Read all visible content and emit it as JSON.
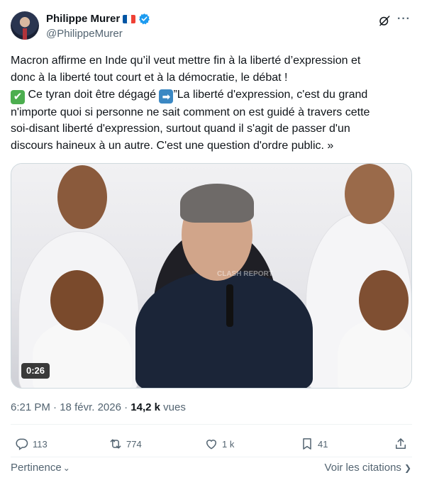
{
  "author": {
    "display_name": "Philippe Murer",
    "handle": "@PhilippeMurer",
    "flag_colors": [
      "#0055a4",
      "#ffffff",
      "#ef4135"
    ],
    "verified_color": "#1d9bf0"
  },
  "header_icons": {
    "grok": "grok-icon",
    "more": "···"
  },
  "tweet": {
    "line1": "Macron affirme en Inde qu’il veut mettre fin à la liberté d’expression et",
    "line2": "donc à la liberté tout court et à la démocratie, le débat !",
    "line3_emoji": "✔",
    "line3_text": " Ce tyran doit être dégagé ",
    "line3_arrow": "➡",
    "line3_quote": "”La liberté d'expression, c'est du grand",
    "line4": "n'importe quoi si personne ne sait comment on est guidé à travers cette",
    "line5": "soi-disant liberté d'expression, surtout quand il s'agit de passer d'un",
    "line6": "discours haineux à un autre. C'est une question d'ordre public. »"
  },
  "media": {
    "duration": "0:26",
    "watermark": "CLASH REPORT"
  },
  "meta": {
    "time": "6:21 PM",
    "separator1": " · ",
    "date": "18 févr. 2026",
    "separator2": " · ",
    "views_count": "14,2 k",
    "views_label": " vues"
  },
  "actions": {
    "replies": "113",
    "reposts": "774",
    "likes": "1 k",
    "bookmarks": "41"
  },
  "footer": {
    "relevance": "Pertinence",
    "quotes": "Voir les citations"
  },
  "colors": {
    "text": "#0f1419",
    "secondary": "#536471",
    "accent": "#1d9bf0"
  }
}
